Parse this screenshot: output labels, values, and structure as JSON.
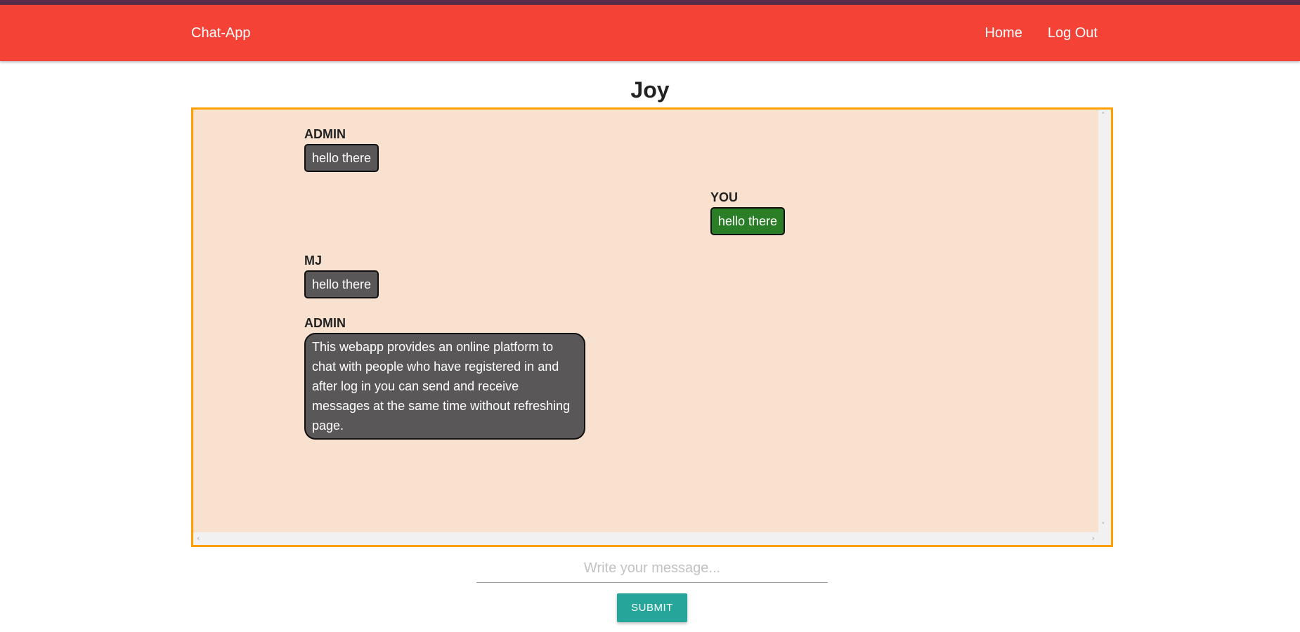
{
  "navbar": {
    "brand": "Chat-App",
    "links": [
      "Home",
      "Log Out"
    ]
  },
  "room": {
    "title": "Joy"
  },
  "messages": [
    {
      "sender": "ADMIN",
      "text": "hello there",
      "is_self": false
    },
    {
      "sender": "YOU",
      "text": "hello there",
      "is_self": true
    },
    {
      "sender": "MJ",
      "text": "hello there",
      "is_self": false
    },
    {
      "sender": "ADMIN",
      "text": "This webapp provides an online platform to chat with people who have registered in and after log in you can send and receive messages at the same time without refreshing page.",
      "is_self": false
    }
  ],
  "composer": {
    "placeholder": "Write your message...",
    "value": "",
    "submit_label": "SUBMIT"
  },
  "colors": {
    "navbar": "#f44336",
    "top_strip": "#5b2c4a",
    "chat_background": "#f8e1cf",
    "chat_border": "#ffa000",
    "other_bubble": "#595757",
    "self_bubble": "#2a7f26",
    "submit_button": "#26a69a"
  }
}
